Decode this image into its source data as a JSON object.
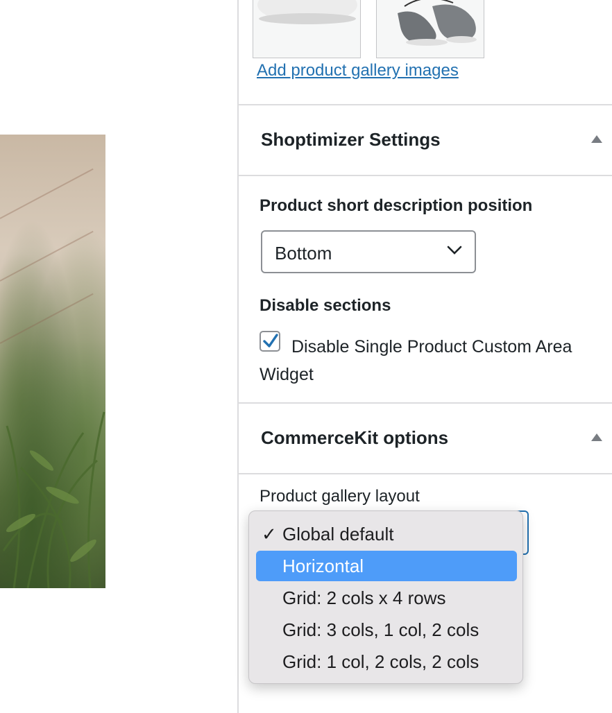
{
  "gallery": {
    "add_link": "Add product gallery images"
  },
  "shoptimizer": {
    "title": "Shoptimizer Settings",
    "short_desc_label": "Product short description position",
    "short_desc_value": "Bottom",
    "disable_sections_label": "Disable sections",
    "disable_widget_label": "Disable Single Product Custom Area Widget",
    "disable_widget_checked": true
  },
  "commercekit": {
    "title": "CommerceKit options",
    "gallery_layout_label": "Product gallery layout",
    "options": [
      {
        "label": "Global default",
        "checked": true,
        "highlighted": false
      },
      {
        "label": "Horizontal",
        "checked": false,
        "highlighted": true
      },
      {
        "label": "Grid: 2 cols x 4 rows",
        "checked": false,
        "highlighted": false
      },
      {
        "label": "Grid: 3 cols, 1 col, 2 cols",
        "checked": false,
        "highlighted": false
      },
      {
        "label": "Grid: 1 col, 2 cols, 2 cols",
        "checked": false,
        "highlighted": false
      }
    ]
  },
  "colors": {
    "link": "#2271b1",
    "checkbox_check": "#2271b1",
    "highlight": "#4e9cf9"
  }
}
